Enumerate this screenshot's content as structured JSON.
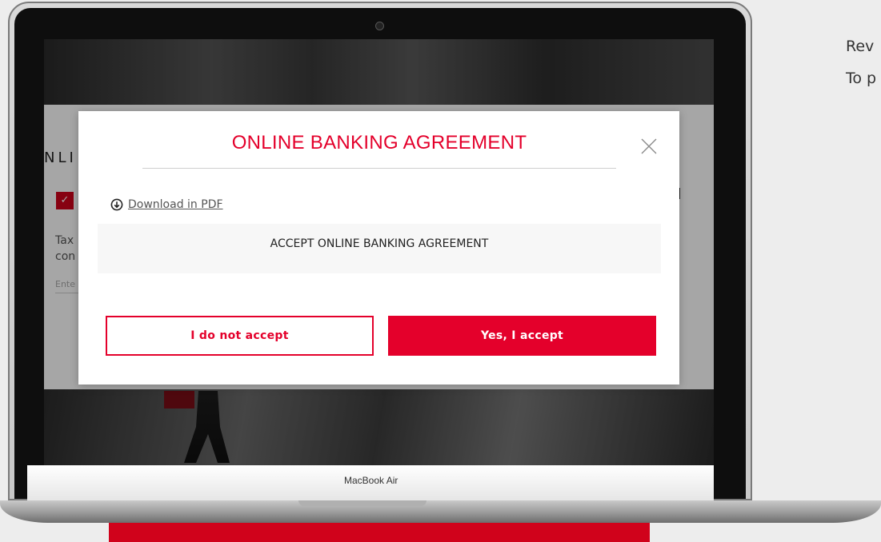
{
  "side_text": {
    "line1": "Rev",
    "line2": "To p"
  },
  "laptop": {
    "brand": "MacBook Air"
  },
  "background_page": {
    "heading_fragment": "NLI",
    "text_line1": "Tax",
    "text_line2": "con",
    "input_placeholder": "Ente"
  },
  "modal": {
    "title": "ONLINE BANKING AGREEMENT",
    "download_label": "Download in PDF",
    "agreement_text": "ACCEPT ONLINE BANKING AGREEMENT",
    "decline_label": "I do not accept",
    "accept_label": "Yes, I accept"
  },
  "colors": {
    "brand_red": "#e4002b",
    "page_background": "#ededed"
  },
  "icons": [
    "close-icon",
    "download-icon",
    "check-icon"
  ]
}
